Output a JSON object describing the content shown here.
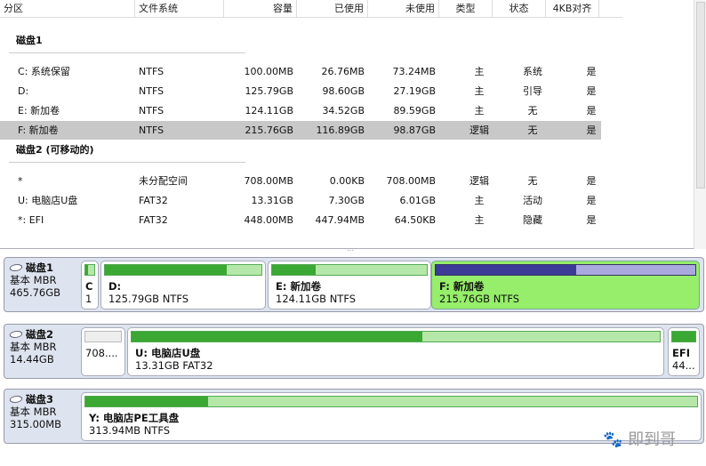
{
  "columns": [
    "分区",
    "文件系统",
    "容量",
    "已使用",
    "未使用",
    "类型",
    "状态",
    "4KB对齐"
  ],
  "disks_list": [
    {
      "title": "磁盘1",
      "rows": [
        {
          "name": "C: 系统保留",
          "fs": "NTFS",
          "cap": "100.00MB",
          "used": "26.76MB",
          "free": "73.24MB",
          "type": "主",
          "status": "系统",
          "align": "是"
        },
        {
          "name": "D:",
          "fs": "NTFS",
          "cap": "125.79GB",
          "used": "98.60GB",
          "free": "27.19GB",
          "type": "主",
          "status": "引导",
          "align": "是"
        },
        {
          "name": "E: 新加卷",
          "fs": "NTFS",
          "cap": "124.11GB",
          "used": "34.52GB",
          "free": "89.59GB",
          "type": "主",
          "status": "无",
          "align": "是"
        },
        {
          "name": "F: 新加卷",
          "fs": "NTFS",
          "cap": "215.76GB",
          "used": "116.89GB",
          "free": "98.87GB",
          "type": "逻辑",
          "status": "无",
          "align": "是",
          "selected": true
        }
      ]
    },
    {
      "title": "磁盘2 (可移动的)",
      "rows": [
        {
          "name": "*",
          "fs": "未分配空间",
          "cap": "708.00MB",
          "used": "0.00KB",
          "free": "708.00MB",
          "type": "逻辑",
          "status": "无",
          "align": "是"
        },
        {
          "name": "U: 电脑店U盘",
          "fs": "FAT32",
          "cap": "13.31GB",
          "used": "7.30GB",
          "free": "6.01GB",
          "type": "主",
          "status": "活动",
          "align": "是"
        },
        {
          "name": "*: EFI",
          "fs": "FAT32",
          "cap": "448.00MB",
          "used": "447.94MB",
          "free": "64.50KB",
          "type": "主",
          "status": "隐藏",
          "align": "是"
        }
      ]
    }
  ],
  "disk_map": [
    {
      "name": "磁盘1",
      "kind": "基本 MBR",
      "size": "465.76GB",
      "parts": [
        {
          "title": "C",
          "info": "1",
          "used": 0.27
        },
        {
          "title": "D:",
          "info": "125.79GB NTFS",
          "used": 0.78
        },
        {
          "title": "E: 新加卷",
          "info": "124.11GB NTFS",
          "used": 0.28
        },
        {
          "title": "F: 新加卷",
          "info": "215.76GB NTFS",
          "used": 0.54,
          "selected": true
        }
      ]
    },
    {
      "name": "磁盘2",
      "kind": "基本 MBR",
      "size": "14.44GB",
      "parts": [
        {
          "title": "",
          "info": "708....",
          "used": 0,
          "unalloc": true
        },
        {
          "title": "U: 电脑店U盘",
          "info": "13.31GB FAT32",
          "used": 0.55
        },
        {
          "title": "EFI",
          "info": "44...",
          "used": 1.0
        }
      ]
    },
    {
      "name": "磁盘3",
      "kind": "基本 MBR",
      "size": "315.00MB",
      "parts": [
        {
          "title": "Y: 电脑店PE工具盘",
          "info": "313.94MB NTFS",
          "used": 0.2
        }
      ]
    }
  ],
  "watermark": "即到哥"
}
